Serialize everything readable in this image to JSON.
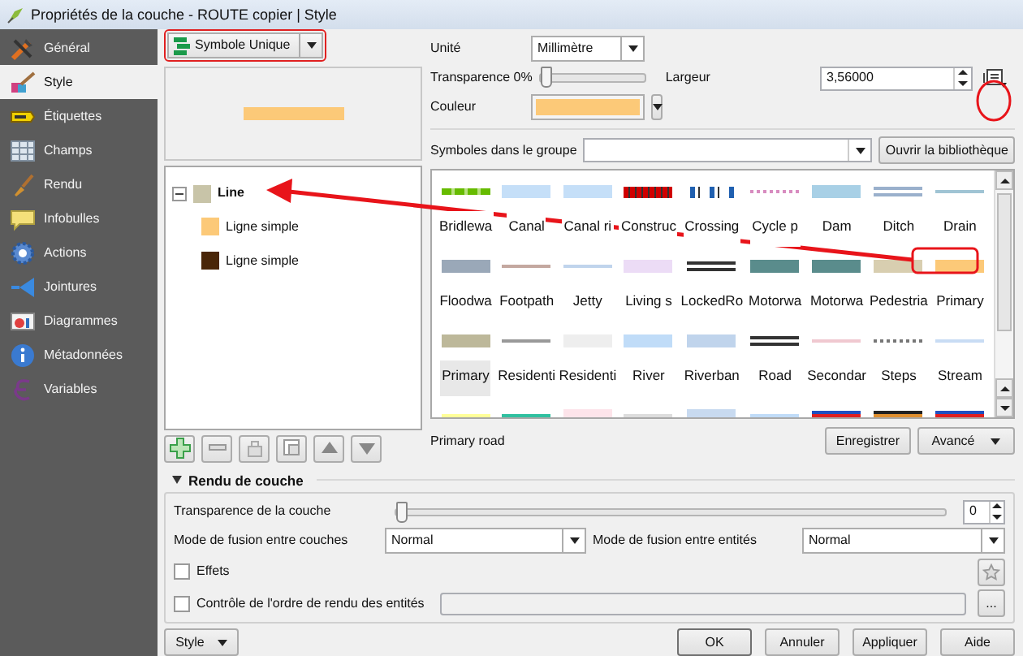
{
  "window": {
    "title": "Propriétés de la couche - ROUTE copier | Style"
  },
  "sidebar": {
    "items": [
      {
        "label": "Général",
        "selected": false
      },
      {
        "label": "Style",
        "selected": true
      },
      {
        "label": "Étiquettes",
        "selected": false
      },
      {
        "label": "Champs",
        "selected": false
      },
      {
        "label": "Rendu",
        "selected": false
      },
      {
        "label": "Infobulles",
        "selected": false
      },
      {
        "label": "Actions",
        "selected": false
      },
      {
        "label": "Jointures",
        "selected": false
      },
      {
        "label": "Diagrammes",
        "selected": false
      },
      {
        "label": "Métadonnées",
        "selected": false
      },
      {
        "label": "Variables",
        "selected": false
      }
    ]
  },
  "renderer": {
    "value": "Symbole Unique"
  },
  "preview": {
    "color": "#fcc978"
  },
  "symbol_tree": {
    "label": "Line",
    "color": "#c8c4a8",
    "expanded": true,
    "children": [
      {
        "label": "Ligne simple",
        "color": "#fcc978"
      },
      {
        "label": "Ligne simple",
        "color": "#4a2608"
      }
    ]
  },
  "properties": {
    "unit": {
      "label": "Unité",
      "value": "Millimètre"
    },
    "transparency": {
      "label": "Transparence 0%",
      "level": 0
    },
    "width": {
      "label": "Largeur",
      "value": "3,56000"
    },
    "color": {
      "label": "Couleur",
      "color": "#fcc978"
    }
  },
  "library": {
    "group_label": "Symboles dans le groupe",
    "open_button": "Ouvrir la bibliothèque",
    "symbols": [
      {
        "label": "Bridlewa",
        "kind": "dashed",
        "color": "#66bb00",
        "selected": false
      },
      {
        "label": "Canal",
        "kind": "thick",
        "color": "#c5dff8",
        "selected": false
      },
      {
        "label": "Canal ri",
        "kind": "thick",
        "color": "#c5dff8",
        "selected": false
      },
      {
        "label": "Construc",
        "kind": "blocks",
        "color": "#d00000",
        "selected": false
      },
      {
        "label": "Crossing",
        "kind": "boxes",
        "color": "#2060b0",
        "selected": false
      },
      {
        "label": "Cycle p",
        "kind": "dotted",
        "color": "#d88cc0",
        "selected": false
      },
      {
        "label": "Dam",
        "kind": "thick",
        "color": "#a8d0e6",
        "selected": false
      },
      {
        "label": "Ditch",
        "kind": "double",
        "color": "#9ab0cc",
        "selected": false
      },
      {
        "label": "Drain",
        "kind": "thin",
        "color": "#a0c4d4",
        "selected": false
      },
      {
        "label": "Floodwa",
        "kind": "thick",
        "color": "#9aa8b8",
        "selected": false
      },
      {
        "label": "Footpath",
        "kind": "thin",
        "color": "#c4a8a0",
        "selected": false
      },
      {
        "label": "Jetty",
        "kind": "thin",
        "color": "#c0d4ec",
        "selected": false
      },
      {
        "label": "Living s",
        "kind": "thick",
        "color": "#ecdcf6",
        "selected": false
      },
      {
        "label": "LockedRo",
        "kind": "double",
        "color": "#333333",
        "selected": false
      },
      {
        "label": "Motorwa",
        "kind": "thick",
        "color": "#5a8c8c",
        "selected": false
      },
      {
        "label": "Motorwa",
        "kind": "thick",
        "color": "#5a8c8c",
        "selected": false
      },
      {
        "label": "Pedestria",
        "kind": "thick",
        "color": "#d8ceb0",
        "selected": false
      },
      {
        "label": "Primary",
        "kind": "thick",
        "color": "#fcc978",
        "selected": false
      },
      {
        "label": "Primary",
        "kind": "thick",
        "color": "#bdb89a",
        "selected": true
      },
      {
        "label": "Residenti",
        "kind": "thin",
        "color": "#999999",
        "selected": false
      },
      {
        "label": "Residenti",
        "kind": "thick",
        "color": "#eeeeee",
        "selected": false
      },
      {
        "label": "River",
        "kind": "thick",
        "color": "#c0dcf8",
        "selected": false
      },
      {
        "label": "Riverban",
        "kind": "thick",
        "color": "#c0d4ec",
        "selected": false
      },
      {
        "label": "Road",
        "kind": "double",
        "color": "#333333",
        "selected": false
      },
      {
        "label": "Secondar",
        "kind": "thin",
        "color": "#f0c8d0",
        "selected": false
      },
      {
        "label": "Steps",
        "kind": "dotted",
        "color": "#777777",
        "selected": false
      },
      {
        "label": "Stream",
        "kind": "thin",
        "color": "#c8dcf4",
        "selected": false
      },
      {
        "kind": "thin",
        "color": "#ffff99",
        "selected": false
      },
      {
        "kind": "thin",
        "color": "#30c0a0",
        "selected": false
      },
      {
        "kind": "thick",
        "color": "#fde4ea",
        "selected": false
      },
      {
        "kind": "thin",
        "color": "#dddddd",
        "selected": false
      },
      {
        "kind": "thick",
        "color": "#c8daf0",
        "selected": false
      },
      {
        "kind": "thin",
        "color": "#c0dcf8",
        "selected": false
      },
      {
        "kind": "striped",
        "color": "#e02020",
        "edge": {
          "color": "#2050c0"
        },
        "selected": false
      },
      {
        "kind": "striped",
        "color": "#e09030",
        "edge": {
          "color": "#222222"
        },
        "selected": false
      },
      {
        "kind": "striped",
        "color": "#e02020",
        "edge": {
          "color": "#2050c0"
        },
        "selected": false
      }
    ],
    "selected_name": "Primary road",
    "save_button": "Enregistrer",
    "advanced_button": "Avancé"
  },
  "layer_rendering": {
    "title": "Rendu de couche",
    "expanded": true,
    "transparency": {
      "label": "Transparence de la couche",
      "level": 0,
      "value": "0"
    },
    "blend_layers": {
      "label": "Mode de fusion entre couches",
      "value": "Normal"
    },
    "blend_features": {
      "label": "Mode de fusion entre entités",
      "value": "Normal"
    },
    "effects": {
      "label": "Effets",
      "checked": false
    },
    "feature_order": {
      "label": "Contrôle de l'ordre de rendu des entités",
      "checked": false,
      "button": "..."
    }
  },
  "footer": {
    "style_button": "Style",
    "buttons": [
      "OK",
      "Annuler",
      "Appliquer",
      "Aide"
    ]
  }
}
